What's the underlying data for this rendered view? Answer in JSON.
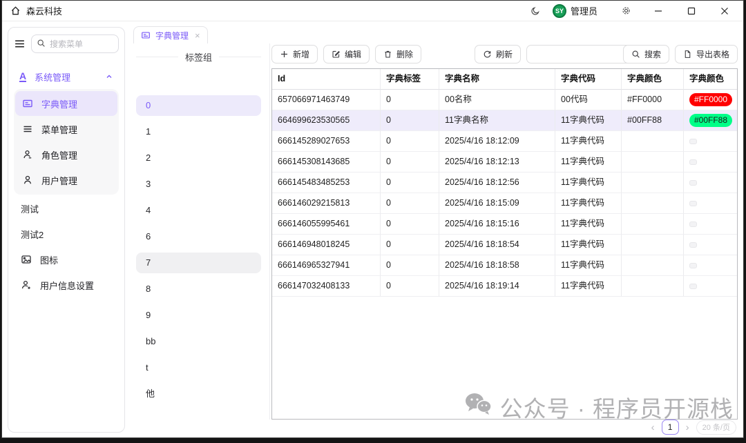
{
  "titlebar": {
    "app_title": "森云科技",
    "user_name": "管理员",
    "avatar_text": "SY"
  },
  "sidebar": {
    "search_placeholder": "搜索菜单",
    "group": {
      "label": "系统管理",
      "icon_letter": "A"
    },
    "menu": [
      {
        "label": "字典管理"
      },
      {
        "label": "菜单管理"
      },
      {
        "label": "角色管理"
      },
      {
        "label": "用户管理"
      }
    ],
    "extra": [
      {
        "label": "测试"
      },
      {
        "label": "测试2"
      },
      {
        "label": "图标"
      },
      {
        "label": "用户信息设置"
      }
    ]
  },
  "tabs": [
    {
      "label": "字典管理"
    }
  ],
  "tag_panel": {
    "title": "标签组",
    "items": [
      "",
      "0",
      "1",
      "2",
      "3",
      "4",
      "6",
      "7",
      "8",
      "9",
      "bb",
      "t",
      "他"
    ],
    "selected_index": 1,
    "hovered_index": 7
  },
  "toolbar": {
    "add_label": "新增",
    "edit_label": "编辑",
    "delete_label": "删除",
    "refresh_label": "刷新",
    "search_label": "搜索",
    "export_label": "导出表格",
    "search_value": ""
  },
  "table": {
    "columns": [
      "Id",
      "字典标签",
      "字典名称",
      "字典代码",
      "字典颜色",
      "字典颜色"
    ],
    "rows": [
      {
        "id": "657066971463749",
        "label": "0",
        "name": "00名称",
        "code": "00代码",
        "color": "#FF0000",
        "badge": {
          "text": "#FF0000",
          "bg": "#FF0000",
          "fg": "#FFFFFF"
        },
        "highlighted": false
      },
      {
        "id": "664699623530565",
        "label": "0",
        "name": "11字典名称",
        "code": "11字典代码",
        "color": "#00FF88",
        "badge": {
          "text": "#00FF88",
          "bg": "#00FF88",
          "fg": "#1A1A1A"
        },
        "highlighted": true
      },
      {
        "id": "666145289027653",
        "label": "0",
        "name": "2025/4/16 18:12:09",
        "code": "11字典代码",
        "color": "",
        "badge": null,
        "highlighted": false
      },
      {
        "id": "666145308143685",
        "label": "0",
        "name": "2025/4/16 18:12:13",
        "code": "11字典代码",
        "color": "",
        "badge": null,
        "highlighted": false
      },
      {
        "id": "666145483485253",
        "label": "0",
        "name": "2025/4/16 18:12:56",
        "code": "11字典代码",
        "color": "",
        "badge": null,
        "highlighted": false
      },
      {
        "id": "666146029215813",
        "label": "0",
        "name": "2025/4/16 18:15:09",
        "code": "11字典代码",
        "color": "",
        "badge": null,
        "highlighted": false
      },
      {
        "id": "666146055995461",
        "label": "0",
        "name": "2025/4/16 18:15:16",
        "code": "11字典代码",
        "color": "",
        "badge": null,
        "highlighted": false
      },
      {
        "id": "666146948018245",
        "label": "0",
        "name": "2025/4/16 18:18:54",
        "code": "11字典代码",
        "color": "",
        "badge": null,
        "highlighted": false
      },
      {
        "id": "666146965327941",
        "label": "0",
        "name": "2025/4/16 18:18:58",
        "code": "11字典代码",
        "color": "",
        "badge": null,
        "highlighted": false
      },
      {
        "id": "666147032408133",
        "label": "0",
        "name": "2025/4/16 18:19:14",
        "code": "11字典代码",
        "color": "",
        "badge": null,
        "highlighted": false
      }
    ]
  },
  "pagination": {
    "current_page": "1",
    "page_size": "20 条/页"
  },
  "watermark": {
    "text": "公众号 · 程序员开源栈"
  },
  "colors": {
    "accent": "#7A5AF8",
    "avatar_bg": "#18A058",
    "row_highlight": "#EFECFB"
  }
}
